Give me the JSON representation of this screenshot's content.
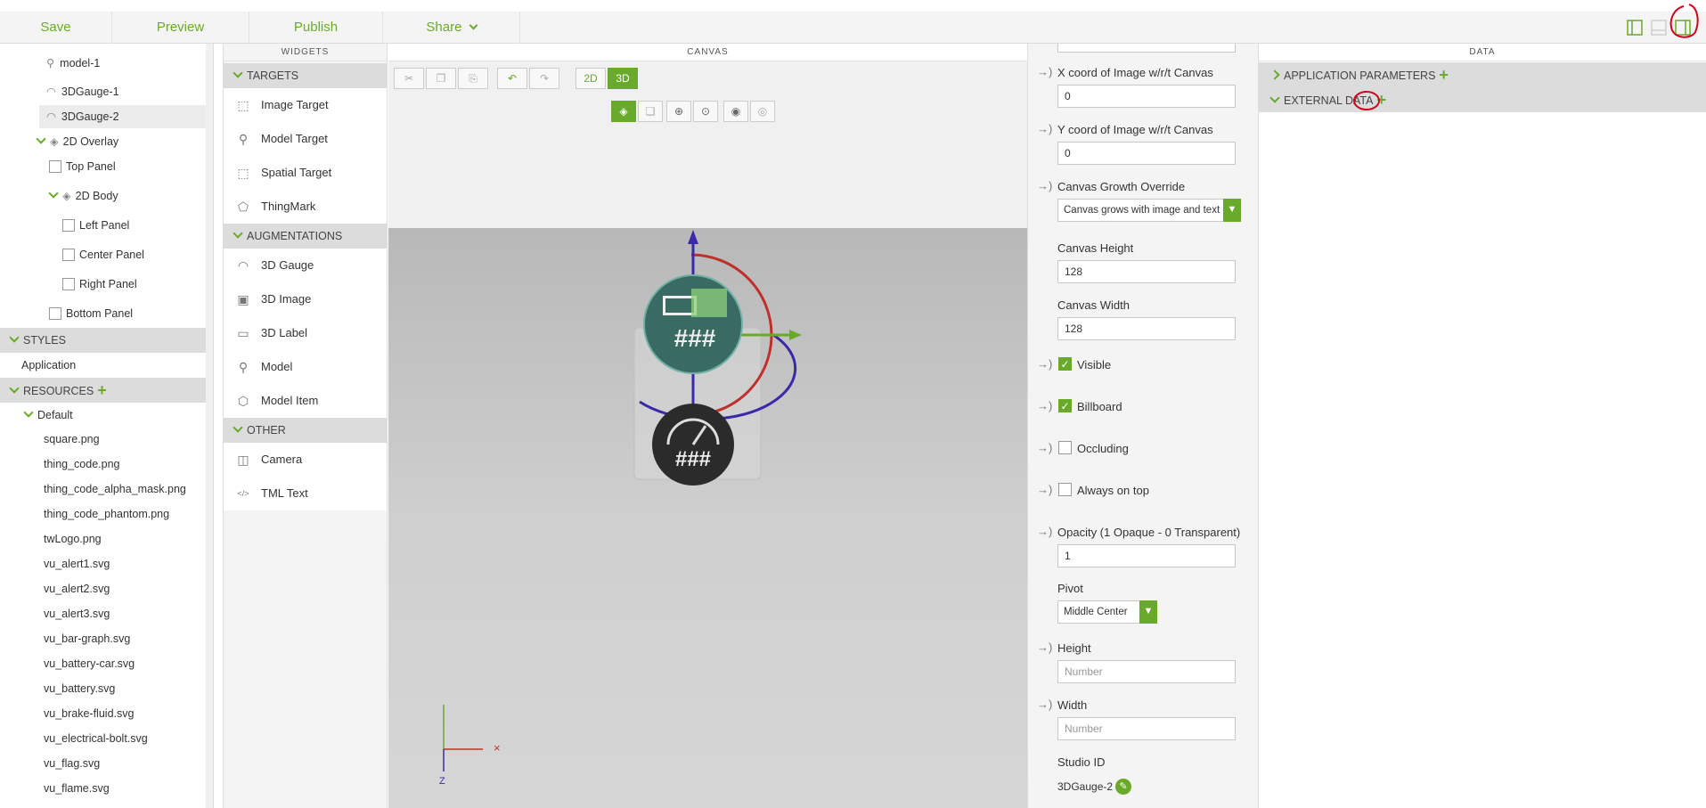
{
  "toolbar": {
    "save": "Save",
    "preview": "Preview",
    "publish": "Publish",
    "share": "Share"
  },
  "tree": {
    "items": [
      {
        "label": "model-1"
      },
      {
        "label": "3DGauge-1"
      },
      {
        "label": "3DGauge-2"
      },
      {
        "label": "2D Overlay"
      },
      {
        "label": "Top Panel"
      },
      {
        "label": "2D Body"
      },
      {
        "label": "Left Panel"
      },
      {
        "label": "Center Panel"
      },
      {
        "label": "Right Panel"
      },
      {
        "label": "Bottom Panel"
      }
    ],
    "styles_header": "STYLES",
    "styles_item": "Application",
    "resources_header": "RESOURCES",
    "default_folder": "Default",
    "resources": [
      "square.png",
      "thing_code.png",
      "thing_code_alpha_mask.png",
      "thing_code_phantom.png",
      "twLogo.png",
      "vu_alert1.svg",
      "vu_alert2.svg",
      "vu_alert3.svg",
      "vu_bar-graph.svg",
      "vu_battery-car.svg",
      "vu_battery.svg",
      "vu_brake-fluid.svg",
      "vu_electrical-bolt.svg",
      "vu_flag.svg",
      "vu_flame.svg"
    ]
  },
  "widgets": {
    "header": "WIDGETS",
    "targets_header": "TARGETS",
    "targets": [
      "Image Target",
      "Model Target",
      "Spatial Target",
      "ThingMark"
    ],
    "augmentations_header": "AUGMENTATIONS",
    "augmentations": [
      "3D Gauge",
      "3D Image",
      "3D Label",
      "Model",
      "Model Item"
    ],
    "other_header": "OTHER",
    "other": [
      "Camera",
      "TML Text"
    ]
  },
  "canvas": {
    "header": "CANVAS",
    "mode_2d": "2D",
    "mode_3d": "3D",
    "gauge_text_top": "###",
    "gauge_text_bottom": "###",
    "axis_z": "Z",
    "axis_x": "×"
  },
  "props": {
    "x_coord_label": "X coord of Image w/r/t Canvas",
    "x_coord_value": "0",
    "y_coord_label": "Y coord of Image w/r/t Canvas",
    "y_coord_value": "0",
    "growth_label": "Canvas Growth Override",
    "growth_value": "Canvas grows with image and text",
    "height_label": "Canvas Height",
    "height_value": "128",
    "width_label": "Canvas Width",
    "width_value": "128",
    "visible_label": "Visible",
    "billboard_label": "Billboard",
    "occluding_label": "Occluding",
    "ontop_label": "Always on top",
    "opacity_label": "Opacity (1 Opaque - 0 Transparent)",
    "opacity_value": "1",
    "pivot_label": "Pivot",
    "pivot_value": "Middle Center",
    "h_label": "Height",
    "h_placeholder": "Number",
    "w_label": "Width",
    "w_placeholder": "Number",
    "studio_id_label": "Studio ID",
    "studio_id_value": "3DGauge-2"
  },
  "data_panel": {
    "header": "DATA",
    "app_params": "APPLICATION PARAMETERS",
    "external_data": "EXTERNAL DATA"
  },
  "colors": {
    "accent": "#6aaa2a",
    "annotation_red": "#d0021b"
  }
}
